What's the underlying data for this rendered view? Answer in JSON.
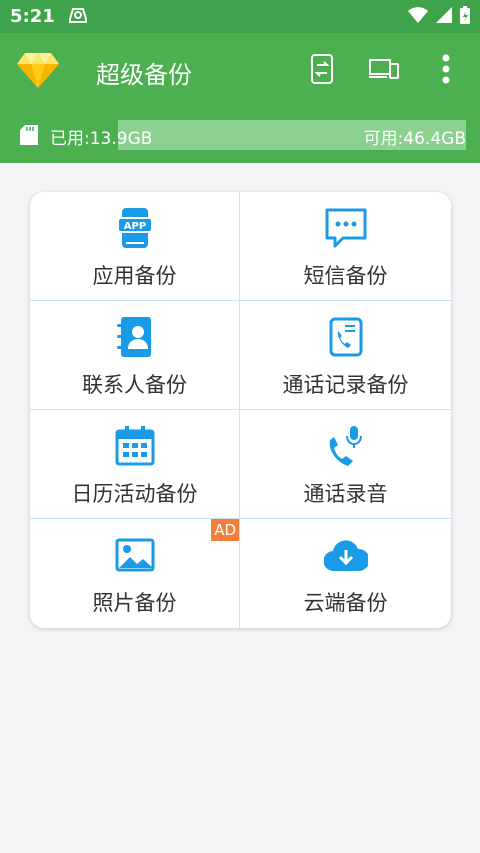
{
  "status_bar": {
    "time": "5:21"
  },
  "app_bar": {
    "title": "超级备份"
  },
  "storage": {
    "used_label": "已用:13.9GB",
    "free_label": "可用:46.4GB",
    "used_fraction": 0.23
  },
  "grid": {
    "items": [
      {
        "label": "应用备份",
        "icon": "app-icon"
      },
      {
        "label": "短信备份",
        "icon": "sms-icon"
      },
      {
        "label": "联系人备份",
        "icon": "contacts-icon"
      },
      {
        "label": "通话记录备份",
        "icon": "call-log-icon"
      },
      {
        "label": "日历活动备份",
        "icon": "calendar-icon"
      },
      {
        "label": "通话录音",
        "icon": "call-recording-icon"
      },
      {
        "label": "照片备份",
        "icon": "photo-icon",
        "badge": "AD"
      },
      {
        "label": "云端备份",
        "icon": "cloud-download-icon"
      }
    ]
  },
  "colors": {
    "primary": "#4caf50",
    "status_bar": "#3ea34a",
    "icon_blue": "#1a9be8",
    "ad_badge": "#f47d3b"
  }
}
